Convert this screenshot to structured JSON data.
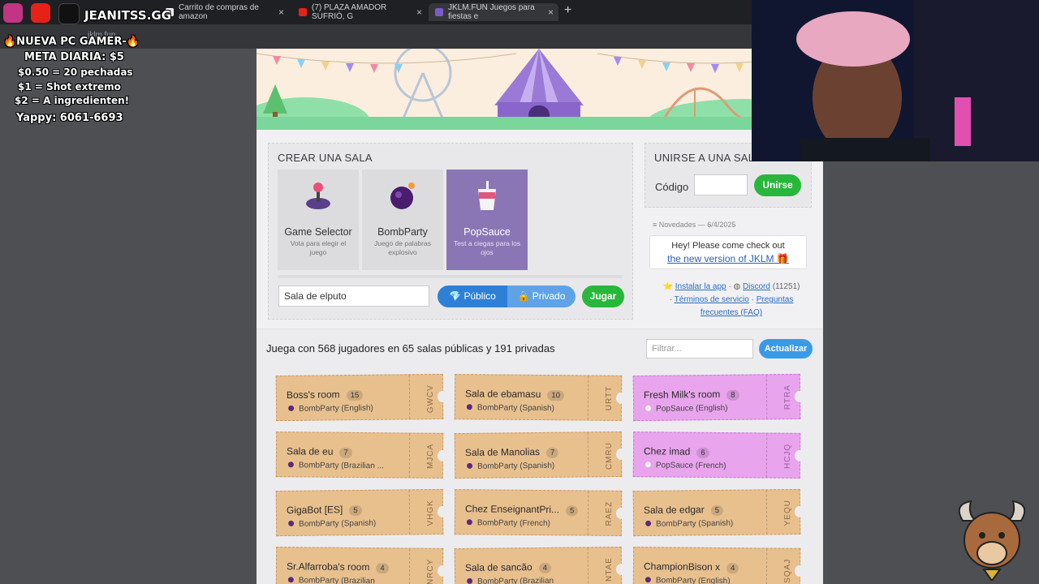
{
  "browser": {
    "tabs": [
      {
        "title": "Carrito de compras de amazon",
        "close": "×"
      },
      {
        "title": "(7) PLAZA AMADOR SUFRIÓ, G",
        "close": "×"
      },
      {
        "title": "JKLM.FUN Juegos para fiestas e",
        "close": "×"
      }
    ],
    "new_tab": "+",
    "url": "jklm.fun"
  },
  "overlay": {
    "channel": "JEANITSS.GG",
    "line1": "🔥NUEVA PC GAMER-🔥",
    "line2": "META DIARIA: $5",
    "line3": "$0.50 = 20 pechadas",
    "line4": "$1 = Shot extremo",
    "line5": "$2 = A ingredienten!",
    "line6": "Yappy: 6061-6693"
  },
  "create": {
    "title": "CREAR UNA SALA",
    "games": [
      {
        "name": "Game Selector",
        "desc": "Vota para elegir el juego",
        "icon": "joystick-icon"
      },
      {
        "name": "BombParty",
        "desc": "Juego de palabras explosivo",
        "icon": "bomb-icon"
      },
      {
        "name": "PopSauce",
        "desc": "Test a ciegas para los ojos",
        "icon": "drink-cup-icon"
      }
    ],
    "room_name_value": "Sala de elputo",
    "public_label": "Público",
    "private_label": "Privado",
    "play_label": "Jugar"
  },
  "join": {
    "title": "UNIRSE A UNA SALA",
    "code_label": "Código",
    "join_label": "Unirse"
  },
  "news": {
    "header": "Novedades — 6/4/2025",
    "line1": "Hey! Please come check out",
    "link": "the new version of JKLM 🎁"
  },
  "links": {
    "install": "Instalar la app",
    "discord": "Discord",
    "discord_count": "(11251)",
    "terms": "Términos de servicio",
    "faq1": "Preguntas",
    "faq2": "frecuentes (FAQ)"
  },
  "lobby": {
    "stats": "Juega con 568 jugadores en 65 salas públicas y 191 privadas",
    "filter_placeholder": "Filtrar...",
    "refresh_label": "Actualizar",
    "rooms": [
      {
        "name": "Boss's room",
        "count": "15",
        "game": "BombParty (English)",
        "code": "GWCV",
        "pink": false
      },
      {
        "name": "Sala de ebamasu",
        "count": "10",
        "game": "BombParty (Spanish)",
        "code": "URTT",
        "pink": false
      },
      {
        "name": "Fresh Milk's room",
        "count": "8",
        "game": "PopSauce (English)",
        "code": "RTRA",
        "pink": true
      },
      {
        "name": "Sala de eu",
        "count": "7",
        "game": "BombParty (Brazilian ...",
        "code": "MJCA",
        "pink": false
      },
      {
        "name": "Sala de Manolias",
        "count": "7",
        "game": "BombParty (Spanish)",
        "code": "CMRU",
        "pink": false
      },
      {
        "name": "Chez imad",
        "count": "6",
        "game": "PopSauce (French)",
        "code": "HCJQ",
        "pink": true
      },
      {
        "name": "GigaBot [ES]",
        "count": "5",
        "game": "BombParty (Spanish)",
        "code": "VHGK",
        "pink": false
      },
      {
        "name": "Chez EnseignantPri...",
        "count": "5",
        "game": "BombParty (French)",
        "code": "RAEZ",
        "pink": false
      },
      {
        "name": "Sala de edgar",
        "count": "5",
        "game": "BombParty (Spanish)",
        "code": "YEQU",
        "pink": false
      },
      {
        "name": "Sr.Alfarroba's room",
        "count": "4",
        "game": "BombParty (Brazilian",
        "code": "NRCY",
        "pink": false
      },
      {
        "name": "Sala de sancão",
        "count": "4",
        "game": "BombParty (Brazilian",
        "code": "NTAE",
        "pink": false
      },
      {
        "name": "ChampionBison x",
        "count": "4",
        "game": "BombParty (English)",
        "code": "SQAJ",
        "pink": false
      }
    ]
  },
  "colors": {
    "accent_green": "#28b73a",
    "accent_blue": "#2e7fd6",
    "popsauce_purple": "#8b76b5",
    "ticket_tan": "#e8c08e",
    "ticket_pink": "#e8a4ec"
  }
}
